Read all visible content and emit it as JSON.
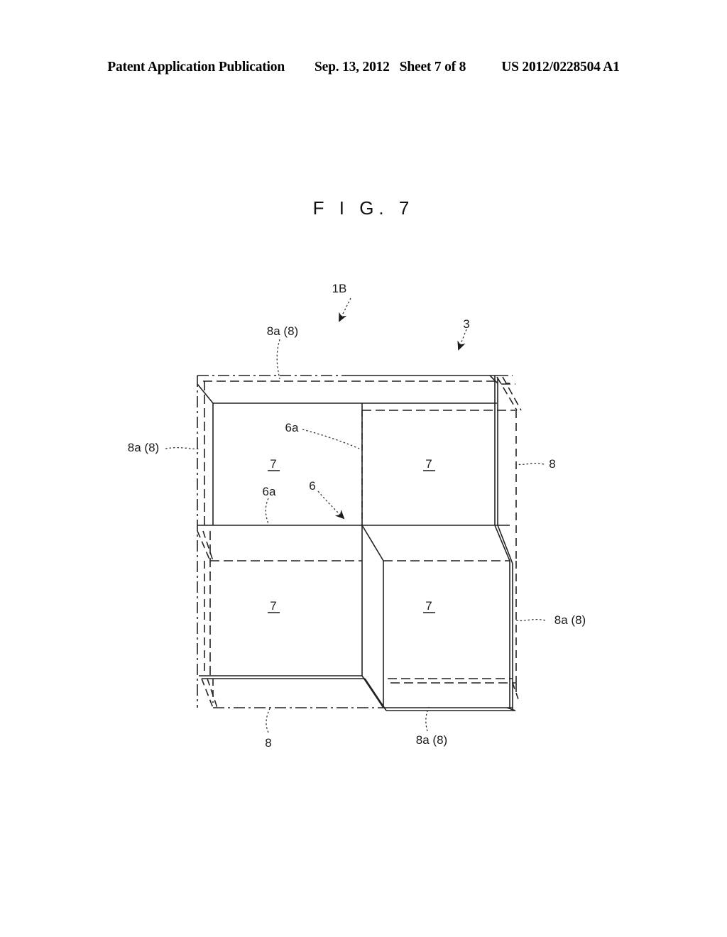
{
  "header": {
    "publication": "Patent Application Publication",
    "date": "Sep. 13, 2012",
    "sheet": "Sheet 7 of 8",
    "number": "US 2012/0228504 A1"
  },
  "figure": {
    "title": "F I G.  7",
    "callouts": {
      "assembly": "1B",
      "frame": "3",
      "panel_top_left": "8a (8)",
      "panel_left": "8a (8)",
      "panel_right_side": "8",
      "panel_right_lower": "8a (8)",
      "panel_bottom_left": "8",
      "panel_bottom_right": "8a (8)",
      "partition_upper": "6a",
      "partition_lower": "6a",
      "partition_center": "6",
      "cell_tl": "7",
      "cell_tr": "7",
      "cell_bl": "7",
      "cell_br": "7"
    }
  },
  "colors": {
    "ink": "#1a1a1a",
    "line": "#222222",
    "background": "#ffffff"
  }
}
